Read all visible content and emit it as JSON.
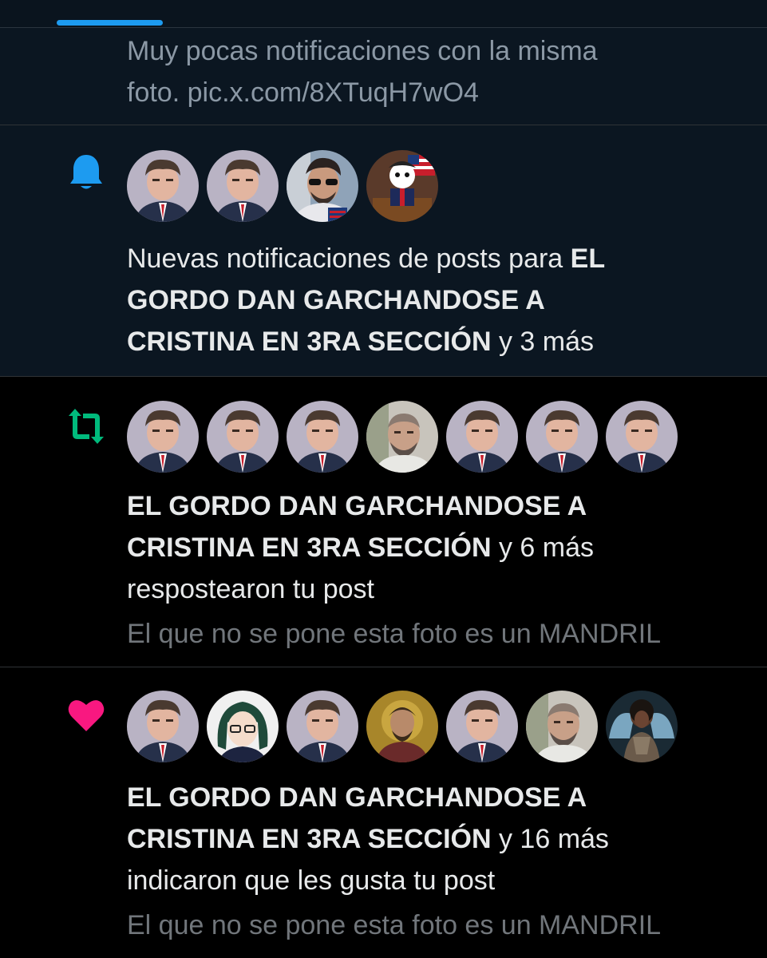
{
  "colors": {
    "accent": "#1d9bf0",
    "retweet": "#00ba7c",
    "like": "#f91880",
    "background_unread": "#0b1621",
    "background_read": "#000000",
    "text": "#e7e9ea",
    "muted": "#71767b"
  },
  "top_post": {
    "line1": "Muy pocas notificaciones con la misma",
    "line2": "foto. pic.x.com/8XTuqH7wO4"
  },
  "notifications": [
    {
      "type": "new-posts",
      "icon": "bell-icon",
      "avatars": [
        "man-in-suit",
        "man-in-suit",
        "man-with-sunglasses",
        "cartoon-character"
      ],
      "text_prefix": "Nuevas notificaciones de posts para ",
      "name_line1": "EL",
      "name_line2": "GORDO DAN GARCHANDOSE A",
      "name_line3": "CRISTINA EN 3RA SECCIÓN",
      "suffix": " y 3 más"
    },
    {
      "type": "repost",
      "icon": "repost-icon",
      "avatars": [
        "man-in-suit",
        "man-in-suit",
        "man-in-suit",
        "bald-man",
        "man-in-suit",
        "man-in-suit",
        "man-in-suit"
      ],
      "name_line1": "EL GORDO DAN GARCHANDOSE A",
      "name_line2": "CRISTINA EN 3RA SECCIÓN",
      "suffix": " y 6 más",
      "action": "respostearon tu post",
      "post_preview": "El que no se pone esta foto es un MANDRIL"
    },
    {
      "type": "like",
      "icon": "heart-icon",
      "avatars": [
        "man-in-suit",
        "anime-girl",
        "man-in-suit",
        "mosaic-portrait",
        "man-in-suit",
        "bald-man",
        "winged-knight"
      ],
      "name_line1": "EL GORDO DAN GARCHANDOSE A",
      "name_line2": "CRISTINA EN 3RA SECCIÓN",
      "suffix": " y 16 más",
      "action": "indicaron que les gusta tu post",
      "post_preview": "El que no se pone esta foto es un MANDRIL"
    }
  ]
}
